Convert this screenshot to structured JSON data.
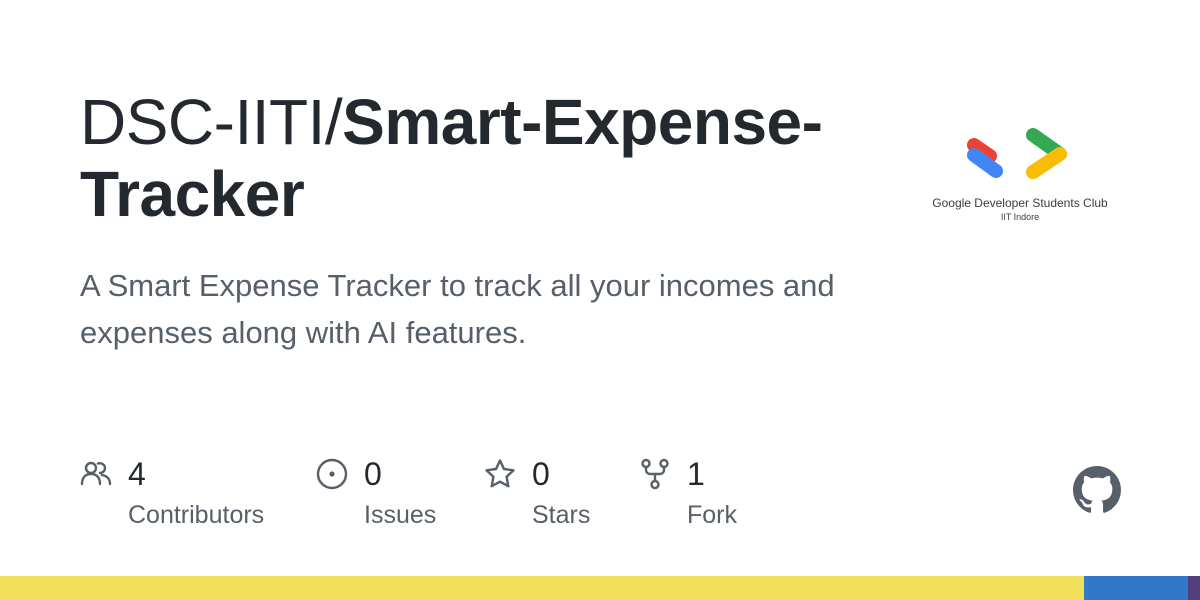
{
  "repo": {
    "owner": "DSC-IITI/",
    "name": "Smart-Expense-Tracker",
    "description": "A Smart Expense Tracker to track all your incomes and expenses along with AI features."
  },
  "logo": {
    "icon": "gdsc-logo-icon",
    "title": "Google Developer Students Club",
    "subtitle": "IIT Indore",
    "colors": {
      "red": "#ea4335",
      "blue": "#4285f4",
      "green": "#34a853",
      "yellow": "#fbbc04"
    }
  },
  "stats": [
    {
      "icon": "people-icon",
      "count": "4",
      "label": "Contributors"
    },
    {
      "icon": "issue-opened-icon",
      "count": "0",
      "label": "Issues"
    },
    {
      "icon": "star-icon",
      "count": "0",
      "label": "Stars"
    },
    {
      "icon": "repo-forked-icon",
      "count": "1",
      "label": "Fork"
    }
  ],
  "github_mark": {
    "icon": "github-mark-icon",
    "color": "#57606a"
  },
  "language_bar": [
    {
      "color": "#f1e05a",
      "fraction": 0.903
    },
    {
      "color": "#3178c6",
      "fraction": 0.087
    },
    {
      "color": "#563d7c",
      "fraction": 0.01
    }
  ],
  "colors": {
    "text_primary": "#24292f",
    "text_secondary": "#57606a",
    "background": "#ffffff"
  }
}
